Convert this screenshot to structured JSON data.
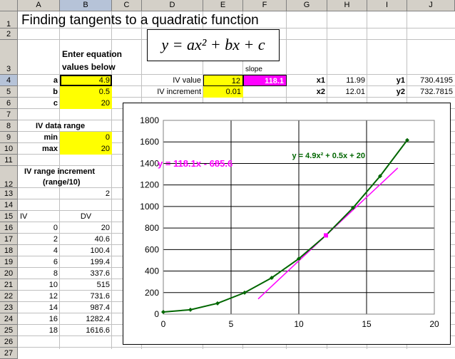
{
  "columns": [
    "A",
    "B",
    "C",
    "D",
    "E",
    "F",
    "G",
    "H",
    "I",
    "J"
  ],
  "rows": [
    "1",
    "2",
    "3",
    "4",
    "5",
    "6",
    "7",
    "8",
    "9",
    "10",
    "11",
    "12",
    "13",
    "14",
    "15",
    "16",
    "17",
    "18",
    "19",
    "20",
    "21",
    "22",
    "23",
    "24",
    "25",
    "26",
    "27"
  ],
  "title": "Finding tangents to a quadratic function",
  "equation_display": "y = ax² + bx + c",
  "inputs": {
    "heading_line1": "Enter equation",
    "heading_line2": "values below",
    "a_label": "a",
    "a_value": "4.9",
    "b_label": "b",
    "b_value": "0.5",
    "c_label": "c",
    "c_value": "20"
  },
  "iv_range": {
    "heading": "IV data range",
    "min_label": "min",
    "min_value": "0",
    "max_label": "max",
    "max_value": "20"
  },
  "increment": {
    "heading_line1": "IV range increment",
    "heading_line2": "(range/10)",
    "value": "2"
  },
  "table": {
    "iv_header": "IV",
    "dv_header": "DV",
    "rows": [
      {
        "iv": "0",
        "dv": "20"
      },
      {
        "iv": "2",
        "dv": "40.6"
      },
      {
        "iv": "4",
        "dv": "100.4"
      },
      {
        "iv": "6",
        "dv": "199.4"
      },
      {
        "iv": "8",
        "dv": "337.6"
      },
      {
        "iv": "10",
        "dv": "515"
      },
      {
        "iv": "12",
        "dv": "731.6"
      },
      {
        "iv": "14",
        "dv": "987.4"
      },
      {
        "iv": "16",
        "dv": "1282.4"
      },
      {
        "iv": "18",
        "dv": "1616.6"
      }
    ]
  },
  "slope_panel": {
    "slope_header": "slope",
    "iv_value_label": "IV value",
    "iv_value": "12",
    "slope_value": "118.1",
    "iv_increment_label": "IV increment",
    "iv_increment": "0.01",
    "x1_label": "x1",
    "x1_value": "11.99",
    "y1_label": "y1",
    "y1_value": "730.4195",
    "x2_label": "x2",
    "x2_value": "12.01",
    "y2_label": "y2",
    "y2_value": "732.7815"
  },
  "colors": {
    "yellow": "#ffff00",
    "magenta": "#ff00ff",
    "curve": "#006600",
    "tangent": "#ff00ff"
  },
  "chart_data": {
    "type": "scatter",
    "title": "",
    "xlabel": "",
    "ylabel": "",
    "xlim": [
      0,
      20
    ],
    "ylim": [
      0,
      1800
    ],
    "xticks": [
      "0",
      "5",
      "10",
      "15",
      "20"
    ],
    "yticks": [
      "0",
      "200",
      "400",
      "600",
      "800",
      "1000",
      "1200",
      "1400",
      "1600",
      "1800"
    ],
    "grid": true,
    "series": [
      {
        "x": [
          0,
          2,
          4,
          6,
          8,
          10,
          12,
          14,
          16,
          18
        ],
        "y": [
          20,
          40.6,
          100.4,
          199.4,
          337.6,
          515,
          731.6,
          987.4,
          1282.4,
          1616.6
        ],
        "color": "#006600"
      },
      {
        "x": [
          7,
          17.3
        ],
        "y": [
          141.1,
          1357.7
        ],
        "color": "#ff00ff"
      },
      {
        "x": [
          12
        ],
        "y": [
          731.6
        ],
        "color": "#ff00ff"
      }
    ],
    "annotations": [
      {
        "text": "y = 118.1x - 685.6",
        "color": "#ff00ff"
      },
      {
        "text": "y = 4.9x² + 0.5x + 20",
        "color": "#006600"
      }
    ]
  }
}
